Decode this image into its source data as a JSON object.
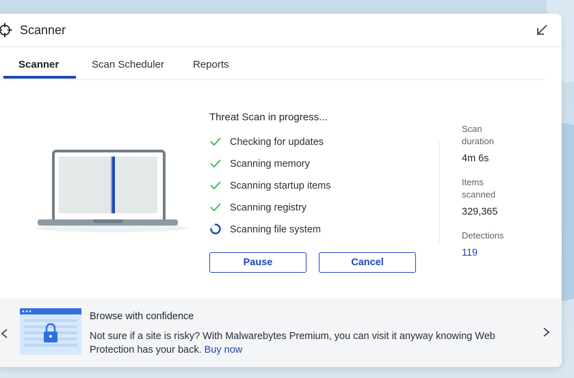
{
  "window": {
    "title": "Scanner"
  },
  "tabs": [
    {
      "label": "Scanner",
      "active": true
    },
    {
      "label": "Scan Scheduler",
      "active": false
    },
    {
      "label": "Reports",
      "active": false
    }
  ],
  "scan": {
    "status_title": "Threat Scan in progress...",
    "steps": [
      {
        "label": "Checking for updates",
        "state": "done"
      },
      {
        "label": "Scanning memory",
        "state": "done"
      },
      {
        "label": "Scanning startup items",
        "state": "done"
      },
      {
        "label": "Scanning registry",
        "state": "done"
      },
      {
        "label": "Scanning file system",
        "state": "in-progress"
      }
    ],
    "pause_label": "Pause",
    "cancel_label": "Cancel"
  },
  "stats": {
    "duration_label": "Scan duration",
    "duration_value": "4m 6s",
    "items_label": "Items scanned",
    "items_value": "329,365",
    "detections_label": "Detections",
    "detections_value": "119"
  },
  "promo": {
    "title": "Browse with confidence",
    "text": "Not sure if a site is risky? With Malwarebytes Premium, you can visit it anyway knowing Web Protection has your back.",
    "link": "Buy now"
  },
  "colors": {
    "accent": "#1f47b6",
    "check": "#2fb84c",
    "laptop_frame": "#6f7f88",
    "laptop_screen": "#e3e8e8"
  },
  "icons": {
    "app": "crosshair-icon",
    "minimize": "arrow-down-left-icon",
    "done": "checkmark-icon",
    "progress": "spinner-icon",
    "prev": "chevron-left-icon",
    "next": "chevron-right-icon",
    "promo": "browser-lock-icon"
  }
}
